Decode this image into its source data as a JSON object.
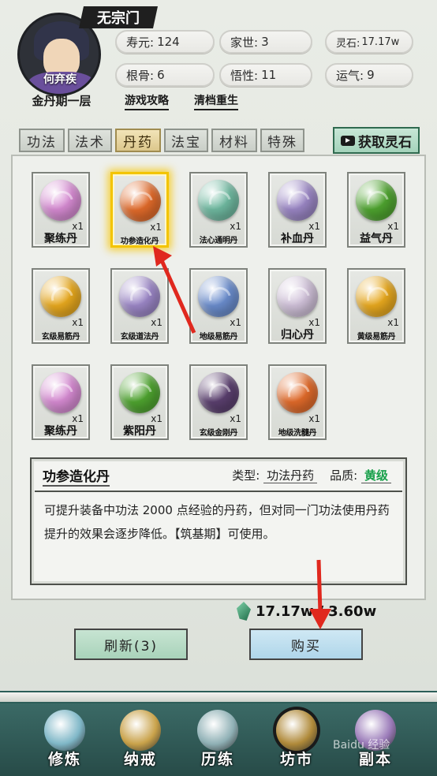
{
  "player": {
    "sect": "无宗门",
    "name": "何弃疾",
    "realm": "金丹期一层",
    "links": [
      "游戏攻略",
      "清档重生"
    ]
  },
  "stats": [
    {
      "label": "寿元:",
      "value": "124"
    },
    {
      "label": "家世:",
      "value": "3"
    },
    {
      "label": "灵石:",
      "value": "17.17w"
    },
    {
      "label": "根骨:",
      "value": "6"
    },
    {
      "label": "悟性:",
      "value": "11"
    },
    {
      "label": "运气:",
      "value": "9"
    }
  ],
  "tabs": [
    "功法",
    "法术",
    "丹药",
    "法宝",
    "材料",
    "特殊"
  ],
  "active_tab": "丹药",
  "get_stones_label": "获取灵石",
  "items": [
    {
      "name": "聚练丹",
      "qty": "x1",
      "color": "#d58ad1"
    },
    {
      "name": "功参造化丹",
      "qty": "x1",
      "color": "#e06a2a",
      "selected": true
    },
    {
      "name": "法心通明丹",
      "qty": "x1",
      "color": "#6fb9a0"
    },
    {
      "name": "补血丹",
      "qty": "x1",
      "color": "#9a86c4"
    },
    {
      "name": "益气丹",
      "qty": "x1",
      "color": "#4ea32f"
    },
    {
      "name": "玄级易筋丹",
      "qty": "x1",
      "color": "#e7a81e"
    },
    {
      "name": "玄级道法丹",
      "qty": "x1",
      "color": "#9b86c6"
    },
    {
      "name": "地级易筋丹",
      "qty": "x1",
      "color": "#6a8ccc"
    },
    {
      "name": "归心丹",
      "qty": "x1",
      "color": "#cfc0d8"
    },
    {
      "name": "黄级易筋丹",
      "qty": "x1",
      "color": "#e7a81e"
    },
    {
      "name": "聚练丹",
      "qty": "x1",
      "color": "#d58ad1"
    },
    {
      "name": "紫阳丹",
      "qty": "x1",
      "color": "#4ea32f"
    },
    {
      "name": "玄级金刚丹",
      "qty": "x1",
      "color": "#5a3f6e"
    },
    {
      "name": "地级洗髓丹",
      "qty": "x1",
      "color": "#e06a2a"
    }
  ],
  "detail": {
    "title": "功参造化丹",
    "type_label": "类型:",
    "type_value": "功法丹药",
    "grade_label": "品质:",
    "grade_value": "黄级",
    "description": "可提升装备中功法 2000 点经验的丹药，但对同一门功法使用丹药提升的效果会逐步降低。【筑基期】可使用。"
  },
  "price": {
    "have": "17.17w",
    "cost": "3.60w"
  },
  "buttons": {
    "refresh": "刷新(3)",
    "buy": "购买"
  },
  "nav": [
    {
      "label": "修炼",
      "icon": "yin-yang-icon",
      "color": "#7fb7c7"
    },
    {
      "label": "纳戒",
      "icon": "ring-icon",
      "color": "#c9a24a"
    },
    {
      "label": "历练",
      "icon": "mountain-icon",
      "color": "#8fb0b5"
    },
    {
      "label": "坊市",
      "icon": "cauldron-icon",
      "color": "#b08a3a",
      "active": true
    },
    {
      "label": "副本",
      "icon": "pagoda-icon",
      "color": "#9a7ab8"
    }
  ]
}
